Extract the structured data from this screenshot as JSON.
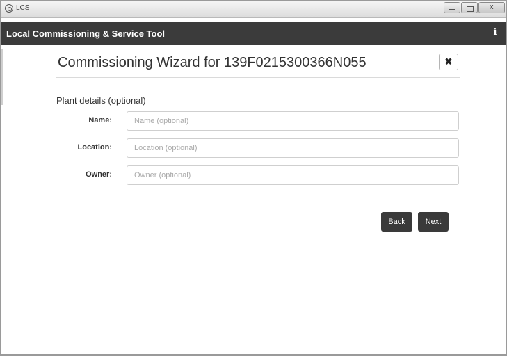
{
  "window": {
    "title": "LCS",
    "controls": [
      "minimize",
      "maximize",
      "close"
    ]
  },
  "appbar": {
    "name": "Local Commissioning & Service Tool",
    "info_icon": "info-icon"
  },
  "wizard": {
    "title": "Commissioning Wizard for 139F0215300366N055",
    "close_icon": "close-icon",
    "section_title": "Plant details (optional)",
    "fields": {
      "name": {
        "label": "Name:",
        "value": "",
        "placeholder": "Name (optional)"
      },
      "location": {
        "label": "Location:",
        "value": "",
        "placeholder": "Location (optional)"
      },
      "owner": {
        "label": "Owner:",
        "value": "",
        "placeholder": "Owner (optional)"
      }
    },
    "buttons": {
      "back": "Back",
      "next": "Next"
    }
  },
  "colors": {
    "appbar_bg": "#3b3b3b",
    "button_bg": "#3a3a3a",
    "input_border": "#cfcfcf"
  }
}
